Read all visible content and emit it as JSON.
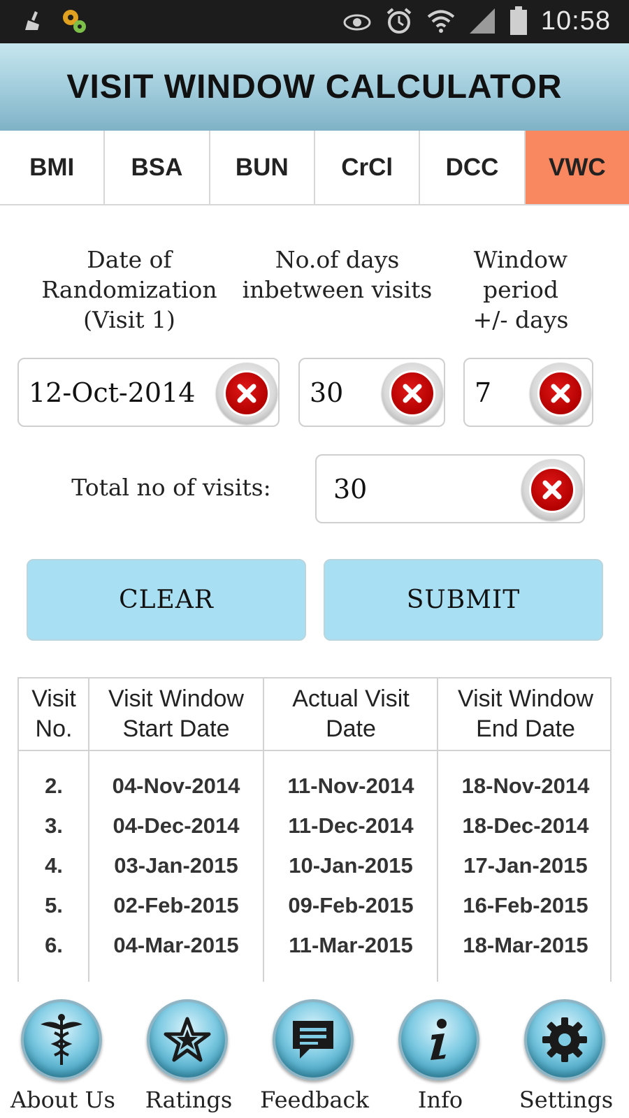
{
  "status_bar": {
    "time": "10:58",
    "icons": [
      "cleaner-icon",
      "settings-gears-icon",
      "eye-icon",
      "alarm-icon",
      "wifi-icon",
      "signal-icon",
      "battery-icon"
    ]
  },
  "header": {
    "title": "VISIT WINDOW CALCULATOR"
  },
  "tabs": [
    {
      "label": "BMI",
      "active": false
    },
    {
      "label": "BSA",
      "active": false
    },
    {
      "label": "BUN",
      "active": false
    },
    {
      "label": "CrCl",
      "active": false
    },
    {
      "label": "DCC",
      "active": false
    },
    {
      "label": "VWC",
      "active": true
    }
  ],
  "form": {
    "date_label_1": "Date of",
    "date_label_2": "Randomization",
    "date_label_3": "(Visit 1)",
    "days_label_1": "No.of days",
    "days_label_2": "inbetween visits",
    "window_label_1": "Window period",
    "window_label_2": "+/- days",
    "date_value": "12-Oct-2014",
    "days_value": "30",
    "window_value": "7",
    "total_label": "Total no of visits:",
    "total_value": "30"
  },
  "buttons": {
    "clear": "CLEAR",
    "submit": "SUBMIT"
  },
  "table": {
    "headers": [
      [
        "Visit",
        "No."
      ],
      [
        "Visit Window",
        "Start Date"
      ],
      [
        "Actual Visit",
        "Date"
      ],
      [
        "Visit Window",
        "End Date"
      ]
    ],
    "rows": [
      [
        "2.",
        "04-Nov-2014",
        "11-Nov-2014",
        "18-Nov-2014"
      ],
      [
        "3.",
        "04-Dec-2014",
        "11-Dec-2014",
        "18-Dec-2014"
      ],
      [
        "4.",
        "03-Jan-2015",
        "10-Jan-2015",
        "17-Jan-2015"
      ],
      [
        "5.",
        "02-Feb-2015",
        "09-Feb-2015",
        "16-Feb-2015"
      ],
      [
        "6.",
        "04-Mar-2015",
        "11-Mar-2015",
        "18-Mar-2015"
      ]
    ]
  },
  "bottom_nav": [
    {
      "label": "About Us",
      "icon": "caduceus-icon"
    },
    {
      "label": "Ratings",
      "icon": "star-icon"
    },
    {
      "label": "Feedback",
      "icon": "chat-bubble-icon"
    },
    {
      "label": "Info",
      "icon": "info-icon"
    },
    {
      "label": "Settings",
      "icon": "gear-icon"
    }
  ],
  "colors": {
    "active_tab": "#f9875f",
    "button_bg": "#a9dff2",
    "clear_icon_red": "#c40000",
    "header_gradient_top": "#c6e6ee"
  }
}
